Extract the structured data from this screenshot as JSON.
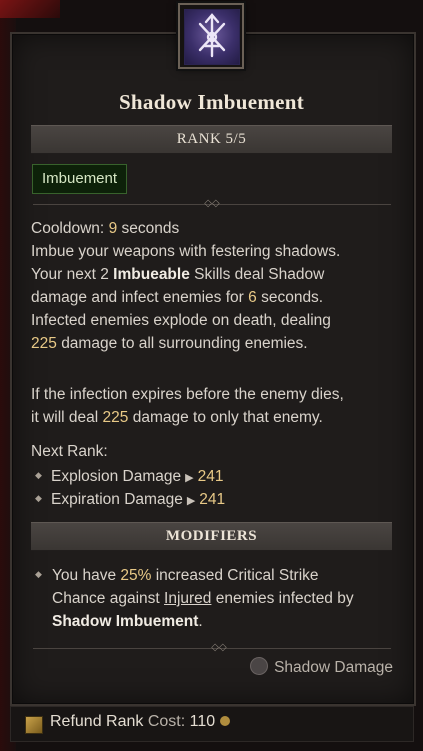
{
  "skill": {
    "title": "Shadow Imbuement",
    "rank": "RANK 5/5",
    "tag": "Imbuement",
    "cooldown_label": "Cooldown:",
    "cooldown_value": "9",
    "cooldown_unit": "seconds",
    "desc_line1": "Imbue your weapons with festering shadows.",
    "desc_line2_a": "Your next",
    "desc_line2_num": "2",
    "desc_line2_hl": "Imbueable",
    "desc_line2_b": "Skills deal Shadow",
    "desc_line3_a": "damage and infect enemies for",
    "desc_line3_num": "6",
    "desc_line3_b": "seconds.",
    "desc_line4": "Infected enemies explode on death, dealing",
    "desc_line5_num": "225",
    "desc_line5_b": "damage to all surrounding enemies.",
    "desc_line6": "If the infection expires before the enemy dies,",
    "desc_line7_a": "it will deal",
    "desc_line7_num": "225",
    "desc_line7_b": "damage to only that enemy.",
    "next_rank_label": "Next Rank:",
    "next_rank": [
      {
        "label": "Explosion Damage",
        "value": "241"
      },
      {
        "label": "Expiration Damage",
        "value": "241"
      }
    ],
    "modifiers_label": "MODIFIERS",
    "modifier": {
      "line1_a": "You have",
      "line1_num": "25%",
      "line1_b": "increased Critical Strike",
      "line2_a": "Chance against",
      "line2_u": "Injured",
      "line2_b": "enemies infected by",
      "line3_hl": "Shadow Imbuement",
      "line3_end": "."
    },
    "damage_type": "Shadow Damage"
  },
  "footer": {
    "refund_label": "Refund Rank",
    "cost_label": "Cost:",
    "cost_value": "110"
  },
  "icons": {
    "skill": "crossed-daggers-icon",
    "damage": "skull-icon",
    "refund": "refund-icon",
    "gold": "gold-coin-icon"
  },
  "colors": {
    "accent_number": "#e8c987",
    "tag_bg": "#0d2109",
    "icon_bg": "#3b2f6a"
  }
}
